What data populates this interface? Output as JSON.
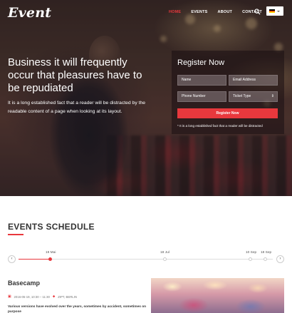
{
  "brand": {
    "logo": "Event",
    "accent": "#e8383d"
  },
  "nav": {
    "items": [
      {
        "label": "HOME",
        "active": true
      },
      {
        "label": "EVENTS",
        "active": false
      },
      {
        "label": "ABOUT",
        "active": false
      },
      {
        "label": "CONTACT",
        "active": false
      }
    ],
    "search_icon": "search-icon",
    "language_flag": "german-flag-icon"
  },
  "hero": {
    "title": "Business it will frequently occur that pleasures have to be repudiated",
    "description": "It is a long established fact that a reader will be distracted by the readable content of a page when looking at its layout."
  },
  "register": {
    "title": "Register Now",
    "name_placeholder": "Name",
    "email_placeholder": "Email Address",
    "phone_placeholder": "Phone Number",
    "ticket_placeholder": "Ticket Type",
    "button_label": "Register Now",
    "note": "* It is a long established fact that a reader will be distracted"
  },
  "schedule": {
    "title": "EVENTS SCHEDULE",
    "timeline": [
      {
        "label": "19 Mai",
        "active": true
      },
      {
        "label": "18 Jul",
        "active": false
      },
      {
        "label": "10 Sep",
        "active": false
      },
      {
        "label": "18 Sep",
        "active": false
      }
    ],
    "prev_icon": "chevron-left-icon",
    "next_icon": "chevron-right-icon"
  },
  "event": {
    "title": "Basecamp",
    "datetime": "2016-05-19, 10:30 – 11:30",
    "location": "ZIPT, BERLIN",
    "description": "Various versions have evolved over the years, sometimes by accident, sometimes on purpose"
  }
}
